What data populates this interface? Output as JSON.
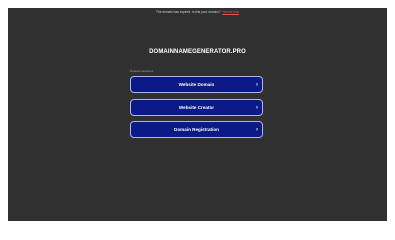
{
  "banner": {
    "text": "The domain has expired. Is this your domain?",
    "link_label": "Renew now"
  },
  "domain": "DOMAINNAMEGENERATOR.PRO",
  "related_label": "Related searches",
  "links": [
    {
      "label": "Website Domain"
    },
    {
      "label": "Website Creator"
    },
    {
      "label": "Domain Registration"
    }
  ],
  "colors": {
    "page_bg": "#303030",
    "button_bg": "#0B1A86",
    "button_border": "#AEB5E8",
    "link": "#E05A4A"
  },
  "icons": [
    "chevron-right-icon"
  ]
}
